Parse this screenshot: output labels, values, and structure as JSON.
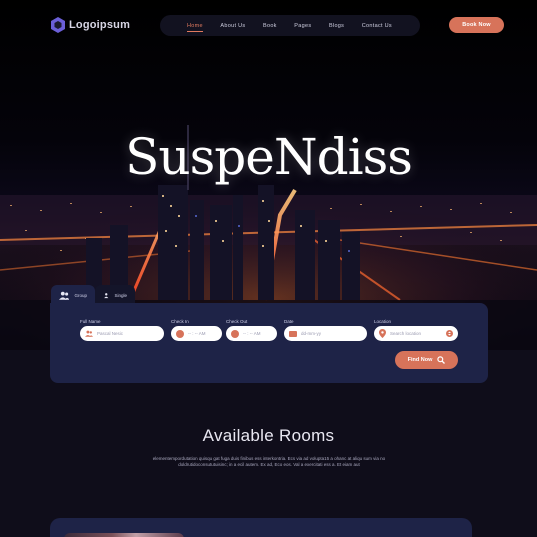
{
  "brand": {
    "name": "Logoipsum"
  },
  "nav": {
    "items": [
      {
        "label": "Home",
        "active": true
      },
      {
        "label": "About Us",
        "active": false
      },
      {
        "label": "Book",
        "active": false
      },
      {
        "label": "Pages",
        "active": false
      },
      {
        "label": "Blogs",
        "active": false
      },
      {
        "label": "Contact Us",
        "active": false
      }
    ],
    "book_now": "Book Now"
  },
  "hero": {
    "title": "SuspeNdiss"
  },
  "search": {
    "tabs": [
      {
        "label": "Group",
        "active": true
      },
      {
        "label": "Single",
        "active": false
      }
    ],
    "fields": {
      "full_name": {
        "label": "Full Name",
        "placeholder": "Pascal Nesic"
      },
      "check_in": {
        "label": "Check In",
        "placeholder": "-- : -- AM"
      },
      "check_out": {
        "label": "Check Out",
        "placeholder": "-- : -- AM"
      },
      "date": {
        "label": "Date",
        "placeholder": "dd-mm-yy"
      },
      "location": {
        "label": "Location",
        "placeholder": "Search location"
      }
    },
    "find_now": "Find Now"
  },
  "rooms": {
    "title": "Available Rooms",
    "description": "elementempordutation quisqu gat fuga duis finibus ess interkontria. Ecs via ad volupta15 a ohanc at aliqu sum via no doldrutidoconsututuisinc; in a ecil autem. Ex ad, Eco eos. Val a exercitati ess a. Et eiam aut"
  },
  "colors": {
    "accent": "#d7735a",
    "panel": "#1e2347",
    "background": "#0f0d1a",
    "nav_bar": "#121220"
  }
}
